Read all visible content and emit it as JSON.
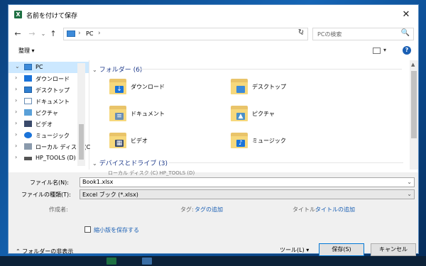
{
  "window": {
    "title": "名前を付けて保存",
    "app_icon": "excel-icon",
    "close_glyph": "✕"
  },
  "nav": {
    "back": "←",
    "forward": "→",
    "recent": "⌄",
    "up": "↑"
  },
  "address": {
    "crumb": "PC",
    "sep": "›",
    "refresh": "↻",
    "dropdown": "⌄"
  },
  "search": {
    "placeholder": "PCの検索",
    "icon": "🔍"
  },
  "toolbar": {
    "organize": "整理 ▾",
    "view_dd": "▾",
    "help": "?"
  },
  "sidebar": {
    "items": [
      {
        "label": "PC",
        "icon": "pc-icon",
        "chev": "⌄",
        "selected": true
      },
      {
        "label": "ダウンロード",
        "icon": "download-icon",
        "chev": "›"
      },
      {
        "label": "デスクトップ",
        "icon": "desktop-icon",
        "chev": "›"
      },
      {
        "label": "ドキュメント",
        "icon": "documents-icon",
        "chev": "›"
      },
      {
        "label": "ピクチャ",
        "icon": "pictures-icon",
        "chev": "›"
      },
      {
        "label": "ビデオ",
        "icon": "video-icon",
        "chev": "›"
      },
      {
        "label": "ミュージック",
        "icon": "music-icon",
        "chev": "›"
      },
      {
        "label": "ローカル ディスク (C",
        "icon": "local-disk-icon",
        "chev": "›"
      },
      {
        "label": "HP_TOOLS (D)",
        "icon": "drive-icon",
        "chev": "›"
      }
    ]
  },
  "content": {
    "folders_group": {
      "label": "フォルダー (6)",
      "chev": "⌄"
    },
    "folders": [
      {
        "name": "ダウンロード",
        "icon": "download-folder-icon",
        "badge": "↓",
        "color": "#1a73d9"
      },
      {
        "name": "デスクトップ",
        "icon": "desktop-folder-icon",
        "badge": "",
        "color": "#3c8ad9"
      },
      {
        "name": "ドキュメント",
        "icon": "documents-folder-icon",
        "badge": "≡",
        "color": "#6b8fb5"
      },
      {
        "name": "ピクチャ",
        "icon": "pictures-folder-icon",
        "badge": "▲",
        "color": "#4a90c8"
      },
      {
        "name": "ビデオ",
        "icon": "video-folder-icon",
        "badge": "▦",
        "color": "#3a4a6b"
      },
      {
        "name": "ミュージック",
        "icon": "music-folder-icon",
        "badge": "♪",
        "color": "#1a73d9"
      }
    ],
    "drives_group": {
      "label": "デバイスとドライブ (3)",
      "chev": "⌄"
    },
    "cut_text": "ローカル ディスク (C)                                         HP_TOOLS (D)"
  },
  "form": {
    "filename_label": "ファイル名(N):",
    "filename_value": "Book1.xlsx",
    "filetype_label": "ファイルの種類(T):",
    "filetype_value": "Excel ブック (*.xlsx)",
    "dropdown": "⌄",
    "author_label": "作成者:",
    "tags_label": "タグ:",
    "tags_value": "タグの追加",
    "title_label": "タイトル:",
    "title_value": "タイトルの追加",
    "thumbnail_label": "縮小版を保存する"
  },
  "footer": {
    "hide_folders": "フォルダーの非表示",
    "hide_chev": "⌃",
    "tools": "ツール(L)   ▾",
    "save": "保存(S)",
    "cancel": "キャンセル"
  },
  "colors": {
    "accent": "#1a5fb4",
    "selection": "#cce8ff",
    "excel": "#1d6f42"
  }
}
